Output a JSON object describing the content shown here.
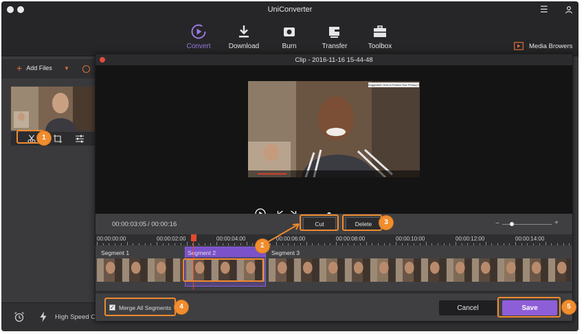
{
  "window": {
    "title": "UniConverter"
  },
  "toolbar": {
    "items": [
      {
        "label": "Convert",
        "icon": "convert-icon",
        "active": true
      },
      {
        "label": "Download",
        "icon": "download-icon",
        "active": false
      },
      {
        "label": "Burn",
        "icon": "burn-icon",
        "active": false
      },
      {
        "label": "Transfer",
        "icon": "transfer-icon",
        "active": false
      },
      {
        "label": "Toolbox",
        "icon": "toolbox-icon",
        "active": false
      }
    ],
    "media_browser": "Media Browers"
  },
  "sidebar": {
    "add_files": "Add Files"
  },
  "bottom_bar": {
    "high_speed": "High Speed Co"
  },
  "dialog": {
    "title": "Clip - 2016-11-16 15-44-48",
    "video_caption": "Suggested: How to Protect Your Privacy Online by Jeff Bennett",
    "playback_progress": 0.2,
    "current_time": "00:00:03:05",
    "total_time": "/ 00:00:16",
    "cut_label": "Cut",
    "delete_label": "Delete",
    "zoom_level": 0.2,
    "ruler": [
      "00:00:00:00",
      "00:00:02:00",
      "00:00:04:00",
      "00:00:06:00",
      "00:00:08:00",
      "00:00:10:00",
      "00:00:12:00",
      "00:00:14:00"
    ],
    "segments": [
      "Segment 1",
      "Segment 2",
      "Segment 3"
    ],
    "merge_label": "Merge All Segments",
    "merge_checked": true,
    "cancel_label": "Cancel",
    "save_label": "Save"
  },
  "callouts": [
    "1",
    "2",
    "3",
    "4",
    "5"
  ],
  "colors": {
    "accent": "#8e5ed8",
    "highlight": "#f08d2e",
    "playhead": "#e0492f"
  }
}
